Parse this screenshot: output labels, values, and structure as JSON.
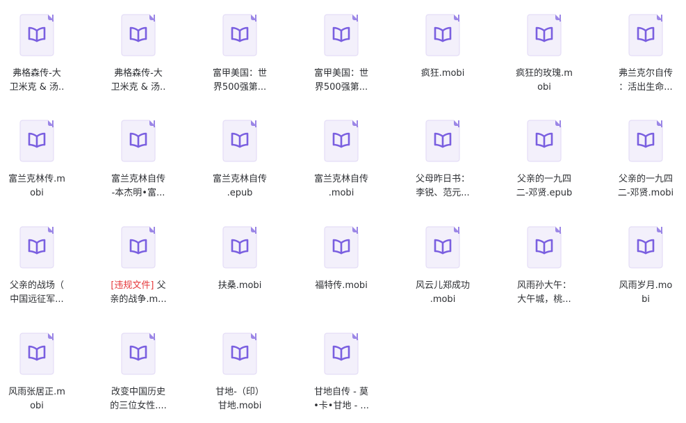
{
  "colors": {
    "doc_body": "#f3f0fb",
    "doc_border": "#e4ddf6",
    "doc_fold": "#9b86e6",
    "book_icon": "#7a5fe0",
    "violation_tag": "#e5383b",
    "text": "#2d2f33"
  },
  "icons": {
    "file_icon": "ebook-file-icon",
    "book_glyph": "open-book-icon"
  },
  "files": [
    {
      "line1": "弗格森传-大",
      "line2": "卫米克 & 汤.."
    },
    {
      "line1": "弗格森传-大",
      "line2": "卫米克 & 汤.."
    },
    {
      "line1": "富甲美国：世",
      "line2": "界500强第..."
    },
    {
      "line1": "富甲美国：世",
      "line2": "界500强第..."
    },
    {
      "line1": "疯狂.mobi",
      "line2": ""
    },
    {
      "line1": "疯狂的玫瑰.m",
      "line2": "obi"
    },
    {
      "line1": "弗兰克尔自传",
      "line2": "：活出生命..."
    },
    {
      "line1": "富兰克林传.m",
      "line2": "obi"
    },
    {
      "line1": "富兰克林自传",
      "line2": "-本杰明•富..."
    },
    {
      "line1": "富兰克林自传",
      "line2": ".epub"
    },
    {
      "line1": "富兰克林自传",
      "line2": ".mobi"
    },
    {
      "line1": "父母昨日书：",
      "line2": "李锐、范元..."
    },
    {
      "line1": "父亲的一九四",
      "line2": "二-邓贤.epub"
    },
    {
      "line1": "父亲的一九四",
      "line2": "二-邓贤.mobi"
    },
    {
      "line1": "父亲的战场（",
      "line2": "中国远征军..."
    },
    {
      "tag": "[违规文件]",
      "line1": " 父",
      "line2": "亲的战争.m..."
    },
    {
      "line1": "扶桑.mobi",
      "line2": ""
    },
    {
      "line1": "福特传.mobi",
      "line2": ""
    },
    {
      "line1": "风云儿郑成功",
      "line2": ".mobi"
    },
    {
      "line1": "风雨孙大午：",
      "line2": "大午城，桃..."
    },
    {
      "line1": "风雨岁月.mo",
      "line2": "bi"
    },
    {
      "line1": "风雨张居正.m",
      "line2": "obi"
    },
    {
      "line1": "改变中国历史",
      "line2": "的三位女性...."
    },
    {
      "line1": "甘地-（印）",
      "line2": "甘地.mobi"
    },
    {
      "line1": "甘地自传 - 莫",
      "line2": "•卡•甘地 - ..."
    }
  ]
}
